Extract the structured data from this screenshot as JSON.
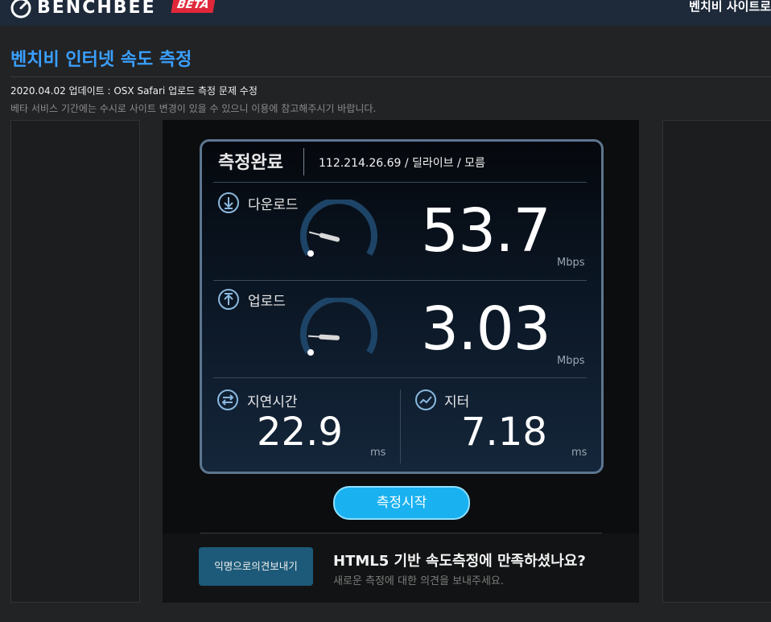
{
  "header": {
    "logo_text": "BENCHBEE",
    "beta_badge": "BETA",
    "nav_link": "벤치비 사이트로"
  },
  "page": {
    "title": "벤치비 인터넷 속도 측정",
    "update_note": "2020.04.02 업데이트 : OSX Safari 업로드 측정 문제 수정",
    "beta_note": "베타 서비스 기간에는 수시로 사이트 변경이 있을 수 있으니 이용에 참고해주시기 바랍니다."
  },
  "result": {
    "status": "측정완료",
    "connection_info": "112.214.26.69 / 딜라이브 / 모름",
    "download": {
      "label": "다운로드",
      "value": "53.7",
      "unit": "Mbps",
      "gauge_level": 0.22
    },
    "upload": {
      "label": "업로드",
      "value": "3.03",
      "unit": "Mbps",
      "gauge_level": 0.18
    },
    "latency": {
      "label": "지연시간",
      "value": "22.9",
      "unit": "ms"
    },
    "jitter": {
      "label": "지터",
      "value": "7.18",
      "unit": "ms"
    }
  },
  "actions": {
    "start_label": "측정시작",
    "feedback_button": "익명으로의견보내기",
    "feedback_title": "HTML5 기반 속도측정에 만족하셨나요?",
    "feedback_subtitle": "새로운 측정에 대한 의견을 보내주세요."
  },
  "colors": {
    "accent": "#3aa0ff",
    "start_button": "#1ab1f0",
    "beta_badge": "#e0283a",
    "gauge_track": "#1d4466",
    "feedback_button": "#1d5a79"
  },
  "icons": {
    "logo": "speedometer-icon",
    "download": "download-arrow-icon",
    "upload": "upload-arrow-icon",
    "latency": "swap-arrows-icon",
    "jitter": "wave-icon"
  }
}
